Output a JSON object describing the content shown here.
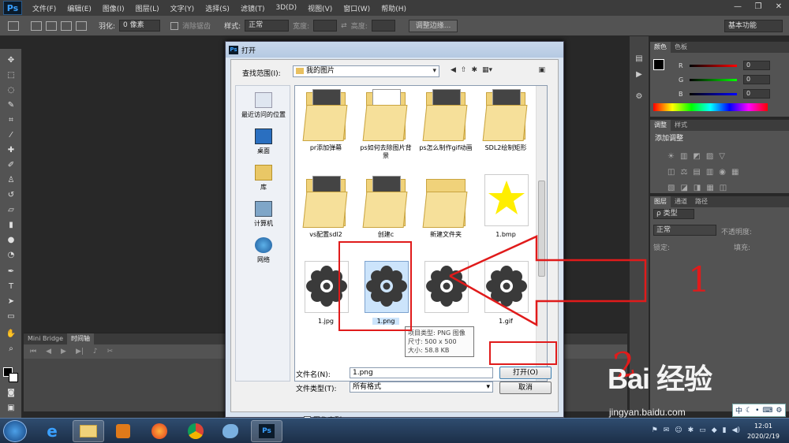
{
  "app": {
    "logo": "Ps",
    "menus": [
      "文件(F)",
      "编辑(E)",
      "图像(I)",
      "图层(L)",
      "文字(Y)",
      "选择(S)",
      "滤镜(T)",
      "3D(D)",
      "视图(V)",
      "窗口(W)",
      "帮助(H)"
    ]
  },
  "options": {
    "feather_label": "羽化:",
    "feather_value": "0 像素",
    "antialias": "消除锯齿",
    "style_label": "样式:",
    "style_value": "正常",
    "width_label": "宽度:",
    "height_label": "高度:",
    "refine_button": "调整边缘...",
    "workspace": "基本功能"
  },
  "timeline": {
    "tabs": [
      "Mini Bridge",
      "时间轴"
    ]
  },
  "color_panel": {
    "tabs": [
      "颜色",
      "色板"
    ],
    "r": {
      "label": "R",
      "value": "0"
    },
    "g": {
      "label": "G",
      "value": "0"
    },
    "b": {
      "label": "B",
      "value": "0"
    }
  },
  "adjust_panel": {
    "tabs": [
      "调整",
      "样式"
    ],
    "title": "添加调整"
  },
  "layers_panel": {
    "tabs": [
      "图层",
      "通道",
      "路径"
    ],
    "kind": "ρ 类型",
    "blend": "正常",
    "opacity_label": "不透明度:",
    "lock_label": "锁定:",
    "fill_label": "填充:"
  },
  "dialog": {
    "title": "打开",
    "lookin_label": "查找范围(I):",
    "lookin_value": "我的图片",
    "places": [
      "最近访问的位置",
      "桌面",
      "库",
      "计算机",
      "网络"
    ],
    "files": [
      {
        "name": "pr添加弹幕",
        "type": "folder"
      },
      {
        "name": "ps如何去除图片背景",
        "type": "folder"
      },
      {
        "name": "ps怎么制作gif动画",
        "type": "folder"
      },
      {
        "name": "SDL2绘制矩形",
        "type": "folder"
      },
      {
        "name": "vs配置sdl2",
        "type": "folder"
      },
      {
        "name": "创建c",
        "type": "folder"
      },
      {
        "name": "新建文件夹",
        "type": "folder"
      },
      {
        "name": "1.bmp",
        "type": "star"
      },
      {
        "name": "1.jpg",
        "type": "gear"
      },
      {
        "name": "1.png",
        "type": "gear"
      },
      {
        "name": "",
        "type": "gear"
      },
      {
        "name": "1.gif",
        "type": "gear"
      }
    ],
    "tooltip": [
      "项目类型: PNG 图像",
      "尺寸: 500 x 500",
      "大小: 58.8 KB"
    ],
    "filename_label": "文件名(N):",
    "filename_value": "1.png",
    "filetype_label": "文件类型(T):",
    "filetype_value": "所有格式",
    "open_button": "打开(O)",
    "cancel_button": "取消",
    "sequence_label": "图像序列"
  },
  "annotations": {
    "one": "1",
    "two": "2"
  },
  "watermark": {
    "brand": "Bai 经验",
    "url": "jingyan.baidu.com"
  },
  "ime": {
    "label": "中"
  },
  "taskbar": {
    "time": "12:01",
    "date": "2020/2/19"
  },
  "colors": {
    "annotation_red": "#e01b1b",
    "ps_bg": "#282828",
    "panel": "#535353"
  }
}
